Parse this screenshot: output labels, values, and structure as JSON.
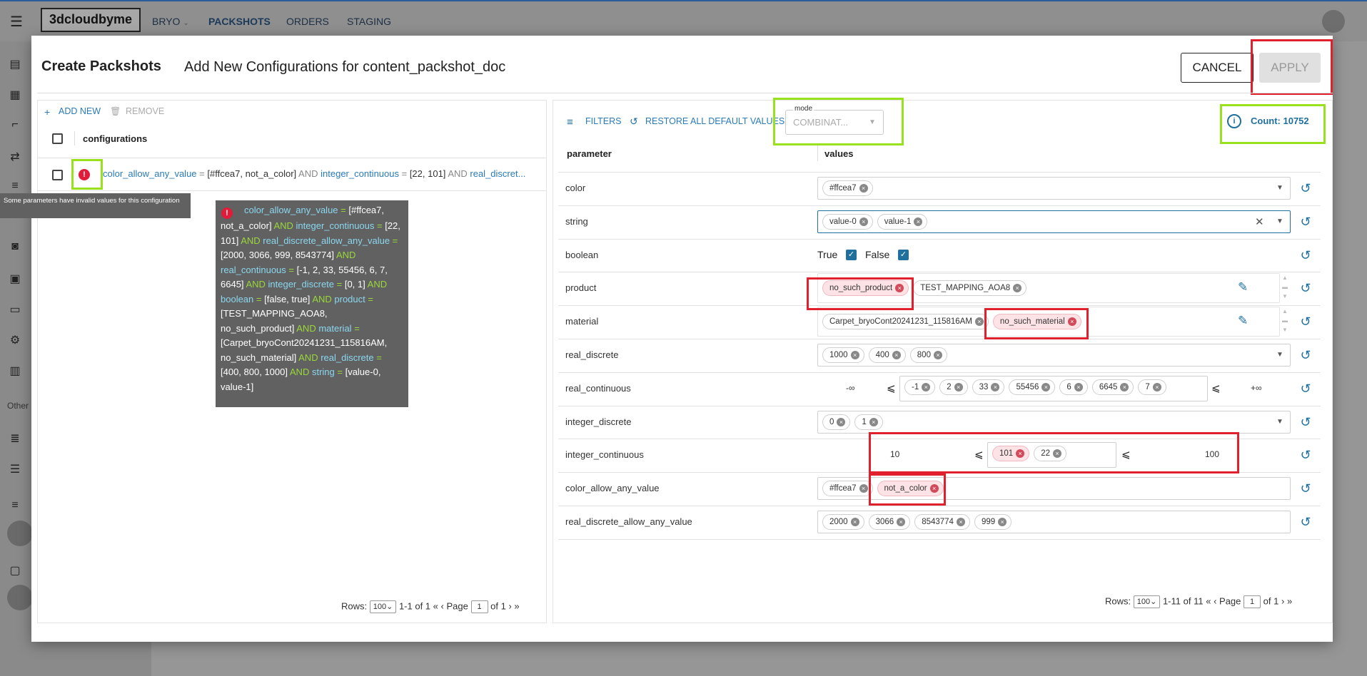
{
  "app": {
    "logo": "3dcloudbyme",
    "nav": [
      {
        "label": "BRYO"
      },
      {
        "label": "PACKSHOTS"
      },
      {
        "label": "ORDERS"
      },
      {
        "label": "STAGING"
      }
    ],
    "sidebar_section_other": "Other"
  },
  "modal": {
    "title": "Create Packshots",
    "subtitle": "Add New Configurations for content_packshot_doc",
    "cancel_label": "CANCEL",
    "apply_label": "APPLY"
  },
  "left": {
    "add_label": "ADD NEW",
    "remove_label": "REMOVE",
    "column_header": "configurations",
    "row": {
      "parts": [
        {
          "t": "color_allow_any_value",
          "k": "key"
        },
        {
          "t": " = ",
          "k": "op"
        },
        {
          "t": "[#ffcea7, not_a_color]",
          "k": "val"
        },
        {
          "t": " AND ",
          "k": "op"
        },
        {
          "t": "integer_continuous",
          "k": "key"
        },
        {
          "t": " = ",
          "k": "op"
        },
        {
          "t": "[22, 101]",
          "k": "val"
        },
        {
          "t": " AND ",
          "k": "op"
        },
        {
          "t": "real_discret...",
          "k": "key"
        }
      ]
    },
    "invalid_tooltip": "Some parameters have invalid values for this configuration",
    "full_tooltip": [
      {
        "t": "color_allow_any_value",
        "k": "key"
      },
      {
        "t": " = ",
        "k": "op"
      },
      {
        "t": "[#ffcea7, not_a_color]",
        "k": "val"
      },
      {
        "t": " AND ",
        "k": "op"
      },
      {
        "t": "integer_continuous",
        "k": "key"
      },
      {
        "t": " = ",
        "k": "op"
      },
      {
        "t": "[22, 101]",
        "k": "val"
      },
      {
        "t": " AND ",
        "k": "op"
      },
      {
        "t": "real_discrete_allow_any_value",
        "k": "key"
      },
      {
        "t": " = ",
        "k": "op"
      },
      {
        "t": "[2000, 3066, 999, 8543774]",
        "k": "val"
      },
      {
        "t": " AND ",
        "k": "op"
      },
      {
        "t": "real_continuous",
        "k": "key"
      },
      {
        "t": " = ",
        "k": "op"
      },
      {
        "t": "[-1, 2, 33, 55456, 6, 7, 6645]",
        "k": "val"
      },
      {
        "t": " AND ",
        "k": "op"
      },
      {
        "t": "integer_discrete",
        "k": "key"
      },
      {
        "t": " = ",
        "k": "op"
      },
      {
        "t": "[0, 1]",
        "k": "val"
      },
      {
        "t": " AND ",
        "k": "op"
      },
      {
        "t": "boolean",
        "k": "key"
      },
      {
        "t": " = ",
        "k": "op"
      },
      {
        "t": "[false, true]",
        "k": "val"
      },
      {
        "t": " AND ",
        "k": "op"
      },
      {
        "t": "product",
        "k": "key"
      },
      {
        "t": " = ",
        "k": "op"
      },
      {
        "t": "[TEST_MAPPING_AOA8, no_such_product]",
        "k": "val"
      },
      {
        "t": " AND ",
        "k": "op"
      },
      {
        "t": "material",
        "k": "key"
      },
      {
        "t": " = ",
        "k": "op"
      },
      {
        "t": "[Carpet_bryoCont20241231_115816AM, no_such_material]",
        "k": "val"
      },
      {
        "t": " AND ",
        "k": "op"
      },
      {
        "t": "real_discrete",
        "k": "key"
      },
      {
        "t": " = ",
        "k": "op"
      },
      {
        "t": "[400, 800, 1000]",
        "k": "val"
      },
      {
        "t": " AND ",
        "k": "op"
      },
      {
        "t": "string",
        "k": "key"
      },
      {
        "t": " = ",
        "k": "op"
      },
      {
        "t": "[value-0, value-1]",
        "k": "val"
      }
    ],
    "pager": {
      "rows_label": "Rows:",
      "rows": "100",
      "range": "1-1 of 1",
      "page_label": "Page",
      "page": "1",
      "of": "of 1"
    }
  },
  "right": {
    "filters_label": "FILTERS",
    "restore_label": "RESTORE ALL DEFAULT VALUES",
    "mode_label": "mode",
    "mode_value": "COMBINAT...",
    "count_label": "Count: 10752",
    "col_parameter": "parameter",
    "col_values": "values",
    "params": {
      "color": {
        "name": "color",
        "chips": [
          "#ffcea7"
        ]
      },
      "string": {
        "name": "string",
        "chips": [
          "value-0",
          "value-1"
        ]
      },
      "boolean": {
        "name": "boolean",
        "true_label": "True",
        "false_label": "False"
      },
      "product": {
        "name": "product",
        "chips": [
          "no_such_product",
          "TEST_MAPPING_AOA8"
        ]
      },
      "material": {
        "name": "material",
        "chips": [
          "Carpet_bryoCont20241231_115816AM",
          "no_such_material"
        ]
      },
      "real_discrete": {
        "name": "real_discrete",
        "chips": [
          "1000",
          "400",
          "800"
        ]
      },
      "real_continuous": {
        "name": "real_continuous",
        "min": "-∞",
        "max": "+∞",
        "chips": [
          "-1",
          "2",
          "33",
          "55456",
          "6",
          "6645",
          "7"
        ]
      },
      "integer_discrete": {
        "name": "integer_discrete",
        "chips": [
          "0",
          "1"
        ]
      },
      "integer_continuous": {
        "name": "integer_continuous",
        "min": "10",
        "max": "100",
        "chips": [
          "101",
          "22"
        ]
      },
      "color_allow_any_value": {
        "name": "color_allow_any_value",
        "chips": [
          "#ffcea7",
          "not_a_color"
        ]
      },
      "real_discrete_allow_any_value": {
        "name": "real_discrete_allow_any_value",
        "chips": [
          "2000",
          "3066",
          "8543774",
          "999"
        ]
      }
    },
    "leq": "⩽",
    "pager": {
      "rows_label": "Rows:",
      "rows": "100",
      "range": "1-11 of 11",
      "page_label": "Page",
      "page": "1",
      "of": "of 1"
    }
  },
  "colors": {
    "accent": "#1f6f9f",
    "link": "#2a7bb8",
    "error": "#e21b3b",
    "highlight_red": "#e0202c",
    "highlight_green": "#99e01d"
  },
  "icons": [
    "menu-icon",
    "chevron-down-icon",
    "avatar-icon",
    "plus-icon",
    "trash-icon",
    "error-icon",
    "filter-icon",
    "restore-icon",
    "info-icon",
    "history-icon",
    "edit-icon",
    "close-icon",
    "checkbox-icon"
  ]
}
